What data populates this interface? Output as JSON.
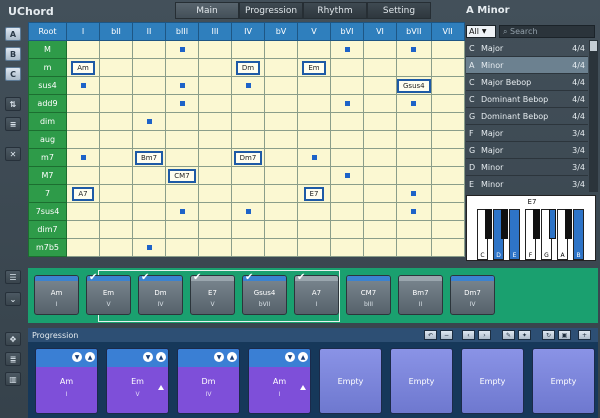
{
  "app_title": "UChord",
  "tabs": [
    "Main",
    "Progression",
    "Rhythm",
    "Setting"
  ],
  "active_tab": "Main",
  "key_title": "A Minor",
  "left_toolbar": {
    "a": "A",
    "b": "B",
    "c": "C"
  },
  "grid": {
    "corner": "Root",
    "columns": [
      "I",
      "bII",
      "II",
      "bIII",
      "III",
      "IV",
      "bV",
      "V",
      "bVI",
      "VI",
      "bVII",
      "VII"
    ],
    "rows": [
      {
        "label": "M",
        "cells": [
          "",
          "",
          "",
          "*",
          "",
          "",
          "",
          "",
          "*",
          "",
          "*",
          ""
        ]
      },
      {
        "label": "m",
        "cells": [
          "Am",
          "",
          "",
          "",
          "",
          "Dm",
          "",
          "Em",
          "",
          "",
          "",
          ""
        ]
      },
      {
        "label": "sus4",
        "cells": [
          "*",
          "",
          "",
          "*",
          "",
          "*",
          "",
          "",
          "",
          "",
          "Gsus4",
          ""
        ]
      },
      {
        "label": "add9",
        "cells": [
          "",
          "",
          "",
          "*",
          "",
          "",
          "",
          "",
          "*",
          "",
          "*",
          ""
        ]
      },
      {
        "label": "dim",
        "cells": [
          "",
          "",
          "*",
          "",
          "",
          "",
          "",
          "",
          "",
          "",
          "",
          ""
        ]
      },
      {
        "label": "aug",
        "cells": [
          "",
          "",
          "",
          "",
          "",
          "",
          "",
          "",
          "",
          "",
          "",
          ""
        ]
      },
      {
        "label": "m7",
        "cells": [
          "*",
          "",
          "Bm7",
          "",
          "",
          "Dm7",
          "",
          "*",
          "",
          "",
          "",
          ""
        ]
      },
      {
        "label": "M7",
        "cells": [
          "",
          "",
          "",
          "CM7",
          "",
          "",
          "",
          "",
          "*",
          "",
          "",
          ""
        ]
      },
      {
        "label": "7",
        "cells": [
          "A7",
          "",
          "",
          "",
          "",
          "",
          "",
          "E7",
          "",
          "",
          "*",
          ""
        ]
      },
      {
        "label": "7sus4",
        "cells": [
          "",
          "",
          "",
          "*",
          "",
          "*",
          "",
          "",
          "",
          "",
          "*",
          ""
        ]
      },
      {
        "label": "dim7",
        "cells": [
          "",
          "",
          "",
          "",
          "",
          "",
          "",
          "",
          "",
          "",
          "",
          ""
        ]
      },
      {
        "label": "m7b5",
        "cells": [
          "",
          "",
          "*",
          "",
          "",
          "",
          "",
          "",
          "",
          "",
          "",
          ""
        ]
      }
    ]
  },
  "key_select": {
    "value": "All",
    "search_placeholder": "Search"
  },
  "scales": [
    {
      "note": "C",
      "name": "Major",
      "meter": "4/4"
    },
    {
      "note": "A",
      "name": "Minor",
      "meter": "4/4",
      "selected": true
    },
    {
      "note": "C",
      "name": "Major Bebop",
      "meter": "4/4"
    },
    {
      "note": "C",
      "name": "Dominant Bebop",
      "meter": "4/4"
    },
    {
      "note": "G",
      "name": "Dominant Bebop",
      "meter": "4/4"
    },
    {
      "note": "F",
      "name": "Major",
      "meter": "3/4"
    },
    {
      "note": "G",
      "name": "Major",
      "meter": "3/4"
    },
    {
      "note": "D",
      "name": "Minor",
      "meter": "3/4"
    },
    {
      "note": "E",
      "name": "Minor",
      "meter": "3/4"
    }
  ],
  "keyboard": {
    "chord": "E7",
    "white_keys": [
      "C",
      "D",
      "E",
      "F",
      "G",
      "A",
      "B"
    ],
    "active_white": [
      "D",
      "E",
      "B"
    ],
    "active_black": [
      "G#"
    ]
  },
  "chord_strip": [
    {
      "name": "Am",
      "roman": "I",
      "checked": false,
      "bar": "blue"
    },
    {
      "name": "Em",
      "roman": "V",
      "checked": true,
      "bar": "blue"
    },
    {
      "name": "Dm",
      "roman": "IV",
      "checked": true,
      "bar": "blue"
    },
    {
      "name": "E7",
      "roman": "V",
      "checked": true,
      "bar": "gray"
    },
    {
      "name": "Gsus4",
      "roman": "bVII",
      "checked": true,
      "bar": "blue"
    },
    {
      "name": "A7",
      "roman": "I",
      "checked": true,
      "bar": "gray"
    },
    {
      "name": "CM7",
      "roman": "bIII",
      "checked": false,
      "bar": "blue"
    },
    {
      "name": "Bm7",
      "roman": "II",
      "checked": false,
      "bar": "gray"
    },
    {
      "name": "Dm7",
      "roman": "IV",
      "checked": false,
      "bar": "blue"
    }
  ],
  "progression": {
    "title": "Progression",
    "slots": [
      {
        "name": "Am",
        "roman": "I",
        "empty": false,
        "marker": false
      },
      {
        "name": "Em",
        "roman": "V",
        "empty": false,
        "marker": true
      },
      {
        "name": "Dm",
        "roman": "IV",
        "empty": false,
        "marker": false
      },
      {
        "name": "Am",
        "roman": "I",
        "empty": false,
        "marker": true
      },
      {
        "name": "Empty",
        "empty": true
      },
      {
        "name": "Empty",
        "empty": true
      },
      {
        "name": "Empty",
        "empty": true
      },
      {
        "name": "Empty",
        "empty": true
      }
    ]
  },
  "colors": {
    "grid_header": "#2f7fbd",
    "row_header": "#2e9b49",
    "cell": "#fbf8d2",
    "strip": "#1aa06f",
    "prog_bg": "#16385a",
    "prog_card": "#7e4fd9"
  }
}
